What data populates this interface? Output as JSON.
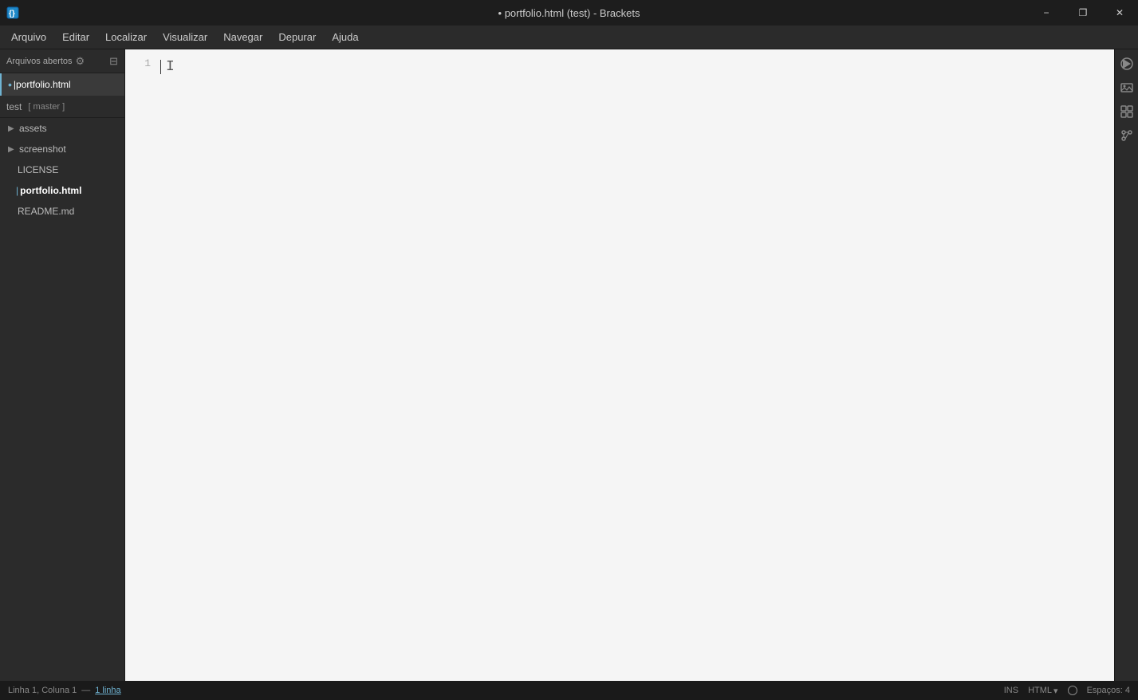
{
  "titleBar": {
    "title": "• portfolio.html (test) - Brackets",
    "minimizeLabel": "−",
    "maximizeLabel": "❐",
    "closeLabel": "✕"
  },
  "menuBar": {
    "items": [
      {
        "label": "Arquivo",
        "id": "arquivo"
      },
      {
        "label": "Editar",
        "id": "editar"
      },
      {
        "label": "Localizar",
        "id": "localizar"
      },
      {
        "label": "Visualizar",
        "id": "visualizar"
      },
      {
        "label": "Navegar",
        "id": "navegar"
      },
      {
        "label": "Depurar",
        "id": "depurar"
      },
      {
        "label": "Ajuda",
        "id": "ajuda"
      }
    ]
  },
  "sidebar": {
    "workingFilesHeader": "Arquivos abertos",
    "settingsIcon": "⚙",
    "splitIcon": "⊟",
    "workingFiles": [
      {
        "name": "portfolio.html",
        "active": true,
        "modified": true
      }
    ],
    "projectName": "test",
    "branchLabel": "[ master ]",
    "fileTree": [
      {
        "type": "folder",
        "name": "assets",
        "expanded": false
      },
      {
        "type": "folder",
        "name": "screenshot",
        "expanded": false
      },
      {
        "type": "file",
        "name": "LICENSE"
      },
      {
        "type": "file",
        "name": "portfolio.html",
        "active": true,
        "modified": true
      },
      {
        "type": "file",
        "name": "README.md"
      }
    ]
  },
  "editor": {
    "lineNumbers": [
      "1"
    ],
    "cursorChar": "I"
  },
  "rightPanel": {
    "buttons": [
      {
        "icon": "⬡",
        "name": "live-preview-icon"
      },
      {
        "icon": "🖼",
        "name": "image-preview-icon"
      },
      {
        "icon": "◈",
        "name": "extension-icon"
      },
      {
        "icon": "↩",
        "name": "git-icon"
      }
    ]
  },
  "statusBar": {
    "position": "Linha 1, Coluna 1",
    "separator": "—",
    "lineCountLink": "1 linha",
    "insertMode": "INS",
    "language": "HTML",
    "spacesLabel": "Espaços: 4"
  }
}
